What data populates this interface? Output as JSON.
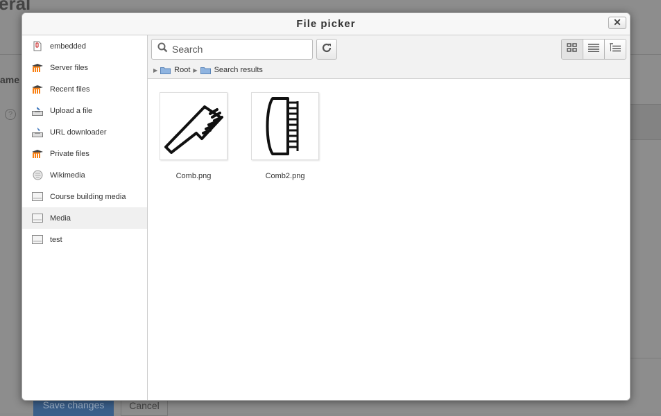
{
  "background": {
    "page_title": "eral",
    "field_label": "ame",
    "help_glyph": "?",
    "save_label": "Save changes",
    "cancel_label": "Cancel"
  },
  "dialog": {
    "title": "File picker",
    "close_glyph": "✕"
  },
  "sidebar": {
    "items": [
      {
        "label": "embedded",
        "icon": "embedded-file-icon"
      },
      {
        "label": "Server files",
        "icon": "moodle-m-icon"
      },
      {
        "label": "Recent files",
        "icon": "moodle-m-icon"
      },
      {
        "label": "Upload a file",
        "icon": "upload-icon"
      },
      {
        "label": "URL downloader",
        "icon": "url-download-icon"
      },
      {
        "label": "Private files",
        "icon": "moodle-m-icon"
      },
      {
        "label": "Wikimedia",
        "icon": "wikimedia-icon"
      },
      {
        "label": "Course building media",
        "icon": "repository-icon"
      },
      {
        "label": "Media",
        "icon": "repository-icon",
        "active": true
      },
      {
        "label": "test",
        "icon": "repository-icon"
      }
    ]
  },
  "toolbar": {
    "search_placeholder": "Search",
    "refresh_icon": "refresh-icon",
    "views": [
      "icons-view-icon",
      "list-view-icon",
      "tree-view-icon"
    ]
  },
  "breadcrumb": {
    "items": [
      "Root",
      "Search results"
    ]
  },
  "files": [
    {
      "name": "Comb.png"
    },
    {
      "name": "Comb2.png"
    }
  ]
}
